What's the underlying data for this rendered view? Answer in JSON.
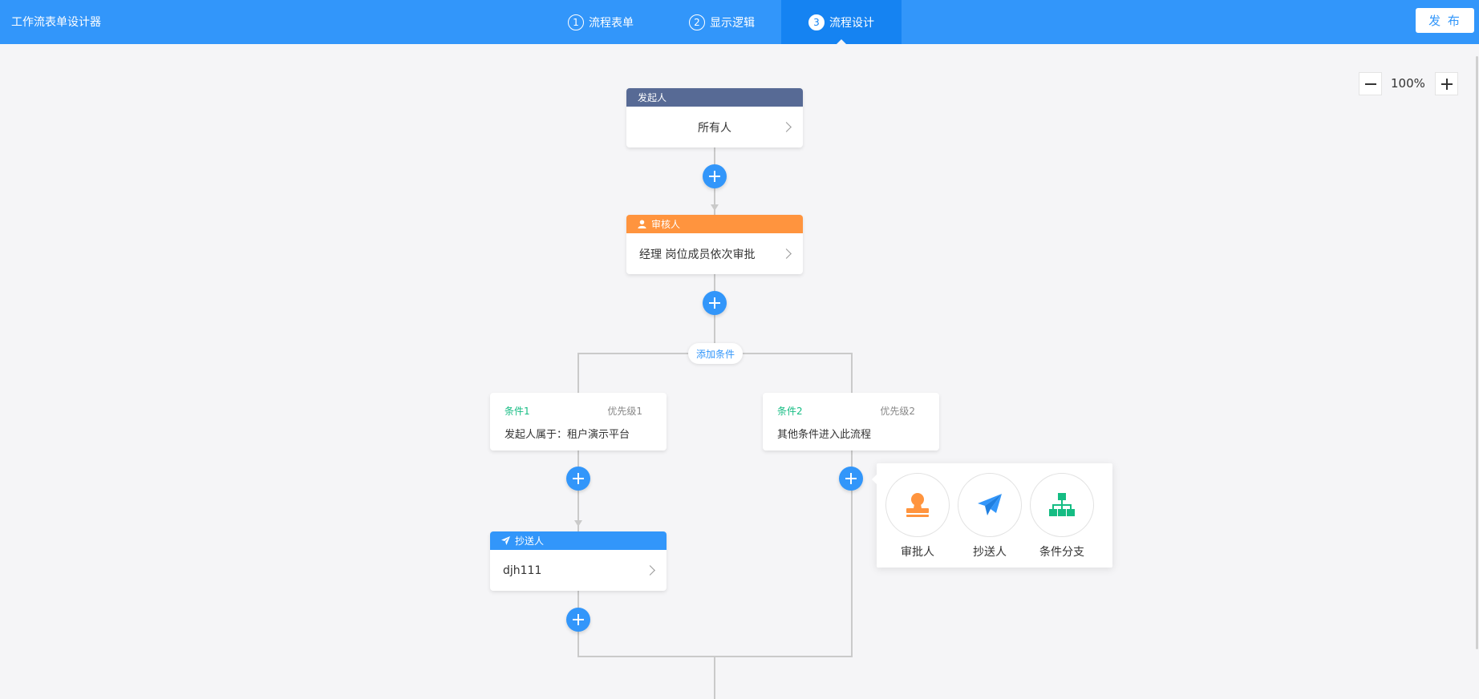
{
  "app": {
    "title": "工作流表单设计器"
  },
  "steps": [
    {
      "num": "1",
      "label": "流程表单"
    },
    {
      "num": "2",
      "label": "显示逻辑"
    },
    {
      "num": "3",
      "label": "流程设计"
    }
  ],
  "publish_label": "发 布",
  "zoom": {
    "value": "100%",
    "minus_icon": "minus-icon",
    "plus_icon": "plus-icon"
  },
  "nodes": {
    "initiator": {
      "header": "发起人",
      "content": "所有人"
    },
    "approver": {
      "header": "审核人",
      "content": "经理 岗位成员依次审批",
      "icon": "user-icon"
    },
    "cc": {
      "header": "抄送人",
      "content": "djh111",
      "icon": "send-icon"
    }
  },
  "add_condition_label": "添加条件",
  "conditions": [
    {
      "title": "条件1",
      "priority": "优先级1",
      "desc": "发起人属于：租户演示平台"
    },
    {
      "title": "条件2",
      "priority": "优先级2",
      "desc": "其他条件进入此流程"
    }
  ],
  "popover": {
    "items": [
      {
        "label": "审批人",
        "icon": "stamp-icon"
      },
      {
        "label": "抄送人",
        "icon": "paper-plane-icon"
      },
      {
        "label": "条件分支",
        "icon": "branch-icon"
      }
    ]
  },
  "colors": {
    "primary": "#3296fa",
    "initiator_header": "#576a95",
    "approver_header": "#ff943e",
    "condition_title": "#15bc83"
  }
}
